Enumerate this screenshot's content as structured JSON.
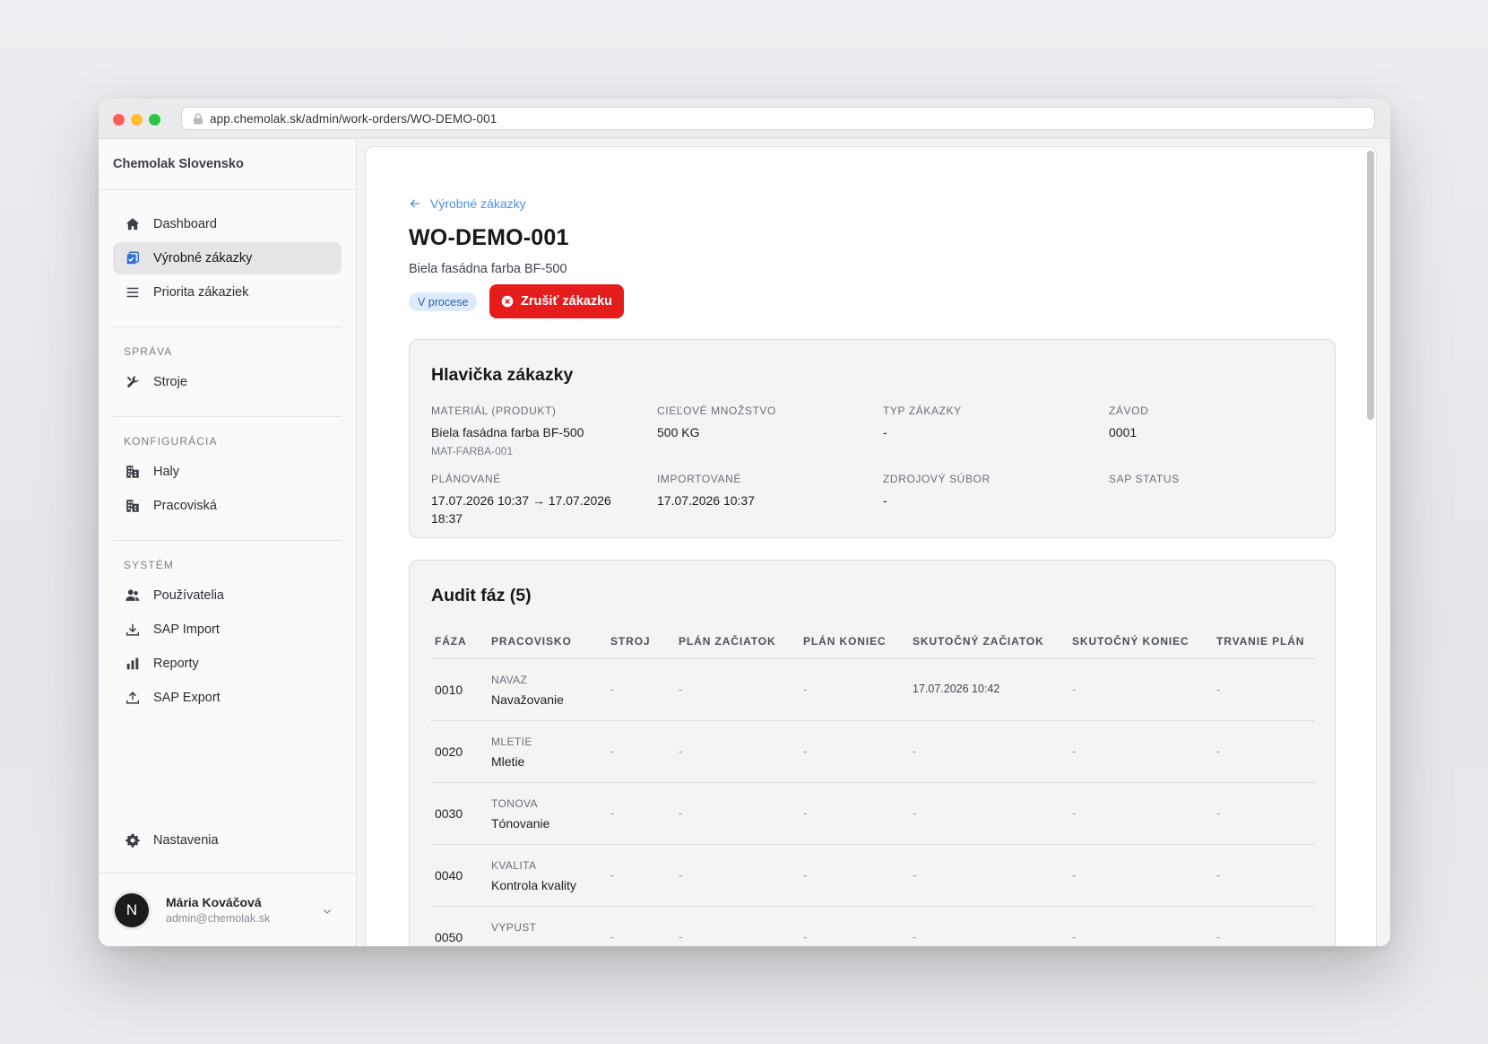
{
  "browser": {
    "url": "app.chemolak.sk/admin/work-orders/WO-DEMO-001"
  },
  "sidebar": {
    "brand": "Chemolak Slovensko",
    "main_items": [
      {
        "label": "Dashboard",
        "icon": "home-icon"
      },
      {
        "label": "Výrobné zákazky",
        "icon": "checklist-icon",
        "active": true
      },
      {
        "label": "Priorita zákaziek",
        "icon": "menu-icon"
      }
    ],
    "sections": [
      {
        "label": "SPRÁVA",
        "items": [
          {
            "label": "Stroje",
            "icon": "tools-icon"
          }
        ]
      },
      {
        "label": "KONFIGURÁCIA",
        "items": [
          {
            "label": "Haly",
            "icon": "building-icon"
          },
          {
            "label": "Pracoviská",
            "icon": "building-icon"
          }
        ]
      },
      {
        "label": "SYSTÉM",
        "items": [
          {
            "label": "Používatelia",
            "icon": "users-icon"
          },
          {
            "label": "SAP Import",
            "icon": "download-icon"
          },
          {
            "label": "Reporty",
            "icon": "bar-chart-icon"
          },
          {
            "label": "SAP Export",
            "icon": "upload-icon"
          }
        ]
      }
    ],
    "settings_label": "Nastavenia",
    "user": {
      "initial": "N",
      "name": "Mária Kováčová",
      "email": "admin@chemolak.sk"
    }
  },
  "page": {
    "back_label": "Výrobné zákazky",
    "title": "WO-DEMO-001",
    "subtitle": "Biela fasádna farba BF-500",
    "status_badge": "V procese",
    "cancel_button": "Zrušiť zákazku"
  },
  "header_panel": {
    "title": "Hlavička zákazky",
    "fields": [
      {
        "label": "MATERIÁL (PRODUKT)",
        "value": "Biela fasádna farba BF-500",
        "sub": "MAT-FARBA-001"
      },
      {
        "label": "CIEĽOVÉ MNOŽSTVO",
        "value": "500 KG"
      },
      {
        "label": "TYP ZÁKAZKY",
        "value": "-"
      },
      {
        "label": "ZÁVOD",
        "value": "0001"
      },
      {
        "label": "PLÁNOVANÉ",
        "value": "17.07.2026 10:37 → 17.07.2026 18:37"
      },
      {
        "label": "IMPORTOVANÉ",
        "value": "17.07.2026 10:37"
      },
      {
        "label": "ZDROJOVÝ SÚBOR",
        "value": "-"
      },
      {
        "label": "SAP STATUS",
        "value": ""
      }
    ]
  },
  "audit_panel": {
    "title": "Audit fáz (5)",
    "columns": [
      "FÁZA",
      "PRACOVISKO",
      "STROJ",
      "PLÁN ZAČIATOK",
      "PLÁN KONIEC",
      "SKUTOČNÝ ZAČIATOK",
      "SKUTOČNÝ KONIEC",
      "TRVANIE PLÁN"
    ],
    "rows": [
      {
        "phase": "0010",
        "wp_code": "NAVAZ",
        "wp_name": "Navažovanie",
        "machine": "-",
        "plan_start": "-",
        "plan_end": "-",
        "actual_start": "17.07.2026 10:42",
        "actual_end": "-",
        "duration": "-"
      },
      {
        "phase": "0020",
        "wp_code": "MLETIE",
        "wp_name": "Mletie",
        "machine": "-",
        "plan_start": "-",
        "plan_end": "-",
        "actual_start": "-",
        "actual_end": "-",
        "duration": "-"
      },
      {
        "phase": "0030",
        "wp_code": "TONOVA",
        "wp_name": "Tónovanie",
        "machine": "-",
        "plan_start": "-",
        "plan_end": "-",
        "actual_start": "-",
        "actual_end": "-",
        "duration": "-"
      },
      {
        "phase": "0040",
        "wp_code": "KVALITA",
        "wp_name": "Kontrola kvality",
        "machine": "-",
        "plan_start": "-",
        "plan_end": "-",
        "actual_start": "-",
        "actual_end": "-",
        "duration": "-"
      },
      {
        "phase": "0050",
        "wp_code": "VYPUST",
        "wp_name": "",
        "machine": "-",
        "plan_start": "-",
        "plan_end": "-",
        "actual_start": "-",
        "actual_end": "-",
        "duration": "-"
      }
    ]
  }
}
